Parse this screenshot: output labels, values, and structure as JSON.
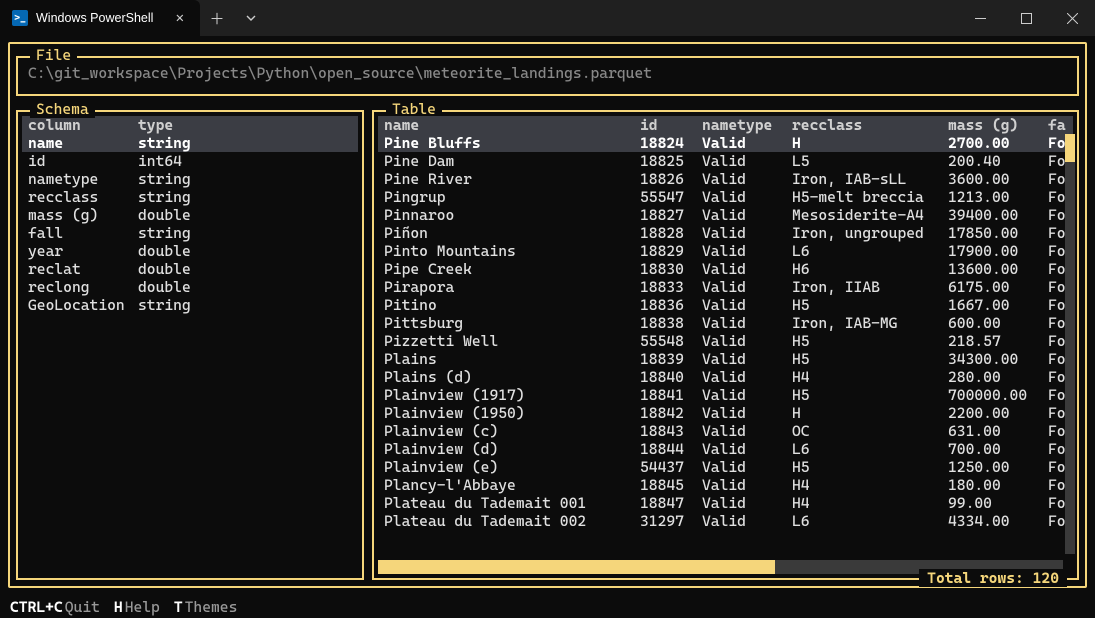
{
  "window": {
    "tab_title": "Windows PowerShell"
  },
  "file": {
    "title": "File",
    "path": "C:\\git_workspace\\Projects\\Python\\open_source\\meteorite_landings.parquet"
  },
  "schema": {
    "title": "Schema",
    "header_col": "column",
    "header_type": "type",
    "columns": [
      {
        "name": "name",
        "type": "string",
        "selected": true
      },
      {
        "name": "id",
        "type": "int64"
      },
      {
        "name": "nametype",
        "type": "string"
      },
      {
        "name": "recclass",
        "type": "string"
      },
      {
        "name": "mass (g)",
        "type": "double"
      },
      {
        "name": "fall",
        "type": "string"
      },
      {
        "name": "year",
        "type": "double"
      },
      {
        "name": "reclat",
        "type": "double"
      },
      {
        "name": "reclong",
        "type": "double"
      },
      {
        "name": "GeoLocation",
        "type": "string"
      }
    ]
  },
  "table": {
    "title": "Table",
    "headers": {
      "name": "name",
      "id": "id",
      "nametype": "nametype",
      "recclass": "recclass",
      "mass": "mass (g)",
      "fall": "fa"
    },
    "rows": [
      {
        "name": "Pine Bluffs",
        "id": "18824",
        "nametype": "Valid",
        "recclass": "H",
        "mass": "2700.00",
        "fall": "Fo",
        "selected": true
      },
      {
        "name": "Pine Dam",
        "id": "18825",
        "nametype": "Valid",
        "recclass": "L5",
        "mass": "200.40",
        "fall": "Fo"
      },
      {
        "name": "Pine River",
        "id": "18826",
        "nametype": "Valid",
        "recclass": "Iron, IAB-sLL",
        "mass": "3600.00",
        "fall": "Fo"
      },
      {
        "name": "Pingrup",
        "id": "55547",
        "nametype": "Valid",
        "recclass": "H5-melt breccia",
        "mass": "1213.00",
        "fall": "Fo"
      },
      {
        "name": "Pinnaroo",
        "id": "18827",
        "nametype": "Valid",
        "recclass": "Mesosiderite-A4",
        "mass": "39400.00",
        "fall": "Fo"
      },
      {
        "name": "Piñon",
        "id": "18828",
        "nametype": "Valid",
        "recclass": "Iron, ungrouped",
        "mass": "17850.00",
        "fall": "Fo"
      },
      {
        "name": "Pinto Mountains",
        "id": "18829",
        "nametype": "Valid",
        "recclass": "L6",
        "mass": "17900.00",
        "fall": "Fo"
      },
      {
        "name": "Pipe Creek",
        "id": "18830",
        "nametype": "Valid",
        "recclass": "H6",
        "mass": "13600.00",
        "fall": "Fo"
      },
      {
        "name": "Pirapora",
        "id": "18833",
        "nametype": "Valid",
        "recclass": "Iron, IIAB",
        "mass": "6175.00",
        "fall": "Fo"
      },
      {
        "name": "Pitino",
        "id": "18836",
        "nametype": "Valid",
        "recclass": "H5",
        "mass": "1667.00",
        "fall": "Fo"
      },
      {
        "name": "Pittsburg",
        "id": "18838",
        "nametype": "Valid",
        "recclass": "Iron, IAB-MG",
        "mass": "600.00",
        "fall": "Fo"
      },
      {
        "name": "Pizzetti Well",
        "id": "55548",
        "nametype": "Valid",
        "recclass": "H5",
        "mass": "218.57",
        "fall": "Fo"
      },
      {
        "name": "Plains",
        "id": "18839",
        "nametype": "Valid",
        "recclass": "H5",
        "mass": "34300.00",
        "fall": "Fo"
      },
      {
        "name": "Plains (d)",
        "id": "18840",
        "nametype": "Valid",
        "recclass": "H4",
        "mass": "280.00",
        "fall": "Fo"
      },
      {
        "name": "Plainview (1917)",
        "id": "18841",
        "nametype": "Valid",
        "recclass": "H5",
        "mass": "700000.00",
        "fall": "Fo"
      },
      {
        "name": "Plainview (1950)",
        "id": "18842",
        "nametype": "Valid",
        "recclass": "H",
        "mass": "2200.00",
        "fall": "Fo"
      },
      {
        "name": "Plainview (c)",
        "id": "18843",
        "nametype": "Valid",
        "recclass": "OC",
        "mass": "631.00",
        "fall": "Fo"
      },
      {
        "name": "Plainview (d)",
        "id": "18844",
        "nametype": "Valid",
        "recclass": "L6",
        "mass": "700.00",
        "fall": "Fo"
      },
      {
        "name": "Plainview (e)",
        "id": "54437",
        "nametype": "Valid",
        "recclass": "H5",
        "mass": "1250.00",
        "fall": "Fo"
      },
      {
        "name": "Plancy-l'Abbaye",
        "id": "18845",
        "nametype": "Valid",
        "recclass": "H4",
        "mass": "180.00",
        "fall": "Fo"
      },
      {
        "name": "Plateau du Tademait 001",
        "id": "18847",
        "nametype": "Valid",
        "recclass": "H4",
        "mass": "99.00",
        "fall": "Fo"
      },
      {
        "name": "Plateau du Tademait 002",
        "id": "31297",
        "nametype": "Valid",
        "recclass": "L6",
        "mass": "4334.00",
        "fall": "Fo"
      }
    ],
    "total_rows_label": "Total rows: 120"
  },
  "statusbar": {
    "items": [
      {
        "key": "CTRL+C",
        "label": "Quit"
      },
      {
        "key": "H",
        "label": "Help"
      },
      {
        "key": "T",
        "label": "Themes"
      }
    ]
  }
}
